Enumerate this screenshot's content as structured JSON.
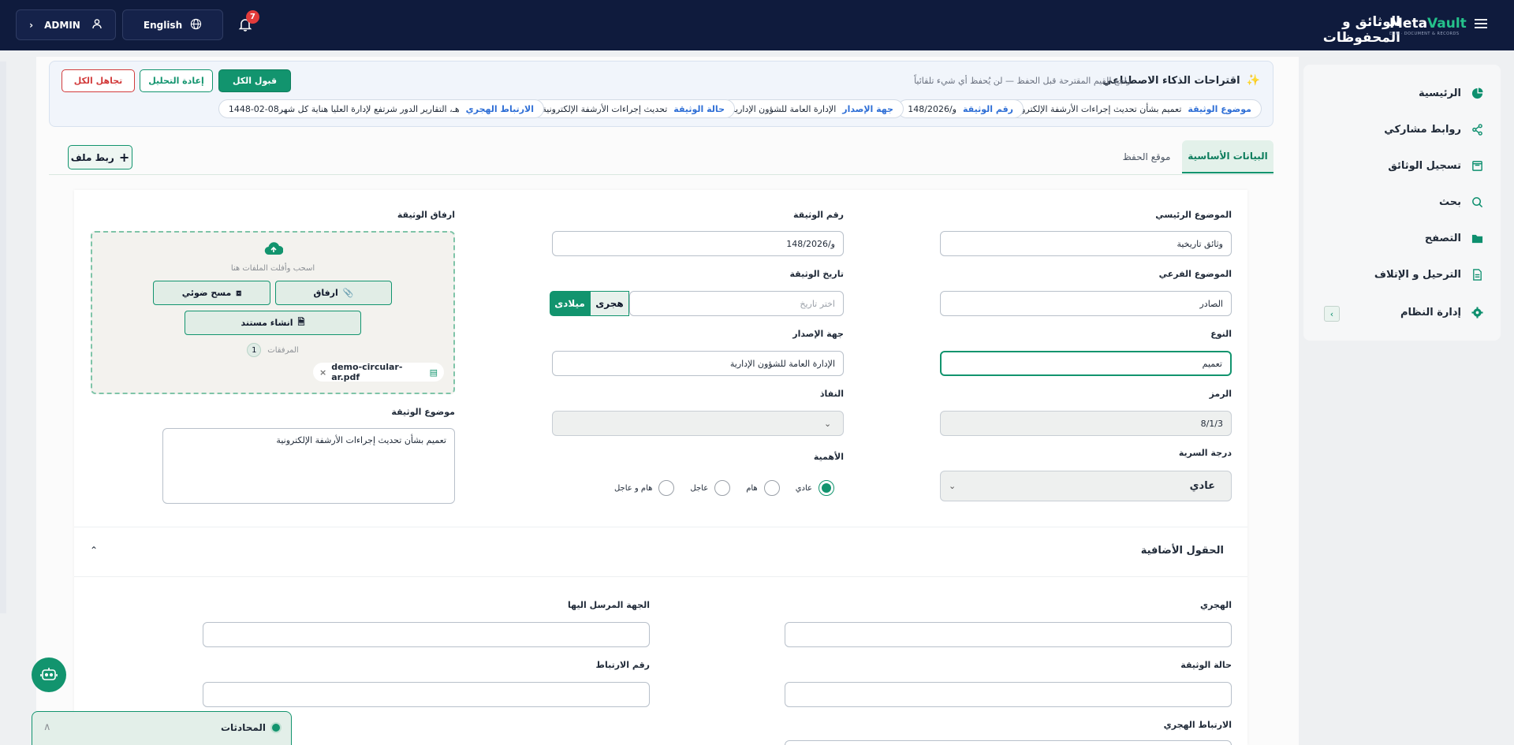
{
  "header": {
    "user_label": "ADMIN",
    "language_label": "English",
    "notifications_count": "7",
    "app_title": "الوثائق و المحفوظات",
    "logo_main_1": "Meta",
    "logo_main_2": "Vault",
    "logo_sub": "ECM · DOCUMENT & RECORDS"
  },
  "sidebar": {
    "items": [
      {
        "label": "الرئيسية",
        "icon": "pie-chart-icon"
      },
      {
        "label": "روابط مشاركي",
        "icon": "share-icon"
      },
      {
        "label": "تسجيل الوثائق",
        "icon": "archive-icon"
      },
      {
        "label": "بحث",
        "icon": "search-icon"
      },
      {
        "label": "التصفح",
        "icon": "folder-icon"
      },
      {
        "label": "الترحيل و الإتلاف",
        "icon": "file-icon"
      },
      {
        "label": "إدارة النظام",
        "icon": "gear-icon"
      }
    ]
  },
  "ai": {
    "title": "اقتراحات الذكاء الاصطناعي",
    "subtitle": "راجع القيم المقترحة قبل الحفظ — لن يُحفظ أي شيء تلقائياً",
    "accept_all": "قبول الكل",
    "reanalyze": "إعادة التحليل",
    "ignore_all": "تجاهل الكل",
    "chips": [
      {
        "key": "موضوع الوثيقة",
        "value": "تعميم بشأن تحديث إجراءات الأرشفة الإلكترونية"
      },
      {
        "key": "رقم الوثيقة",
        "value": "و/148/2026"
      },
      {
        "key": "جهة الإصدار",
        "value": "الإدارة العامة للشؤون الإدارية"
      },
      {
        "key": "حالة الوثيقة",
        "value": "تحديث إجراءات الأرشفة الإلكترونية"
      },
      {
        "key": "الارتباط الهجري",
        "value": "1448-02-08هـ، التقارير الدور شرتفع لإدارة العليا هناية كل شهر"
      }
    ]
  },
  "tabs": {
    "basic": "البيانات الأساسية",
    "location": "موقع الحفظ",
    "link_file": "ربط ملف"
  },
  "form": {
    "main_subject_label": "الموضوع الرئيسي",
    "main_subject_value": "وثائق تاريخية",
    "sub_subject_label": "الموضوع الفرعي",
    "sub_subject_value": "الصادر",
    "type_label": "النوع",
    "type_value": "تعميم",
    "code_label": "الرمز",
    "code_value": "8/1/3",
    "secrecy_label": "درجة السرية",
    "secrecy_value": "عادي",
    "doc_number_label": "رقم الوثيقة",
    "doc_number_value": "و/148/2026",
    "doc_date_label": "تاريخ الوثيقة",
    "doc_date_placeholder": "اختر تاريخ",
    "hijri": "هجرى",
    "gregorian": "ميلادى",
    "issuer_label": "جهة الإصدار",
    "issuer_value": "الإدارة العامة للشؤون الإدارية",
    "enforcement_label": "النفاذ",
    "importance_label": "الأهمية",
    "importance_options": [
      "عادي",
      "هام",
      "عاجل",
      "هام و عاجل"
    ],
    "attachments_label": "ارفاق الوثيقة",
    "drop_text": "اسحب وأفلت الملفات هنا",
    "attach_btn": "ارفاق",
    "scan_btn": "مسح ضوئي",
    "create_doc_btn": "انشاء مستند",
    "attachments_count_label": "المرفقات",
    "attachments_count": "1",
    "file_name": "demo-circular-ar.pdf",
    "doc_subject_label": "موضوع الوثيقة",
    "doc_subject_value": "تعميم بشأن تحديث إجراءات الأرشفة الإلكترونية"
  },
  "extra": {
    "title": "الحقول الأضافية",
    "hijri_label": "الهجري",
    "recipient_label": "الجهة المرسل اليها",
    "doc_status_label": "حالة الوثيقة",
    "link_number_label": "رقم الارتباط",
    "hijri_link_label": "الارتباط الهجري"
  },
  "chat": {
    "title": "المحادثات"
  }
}
